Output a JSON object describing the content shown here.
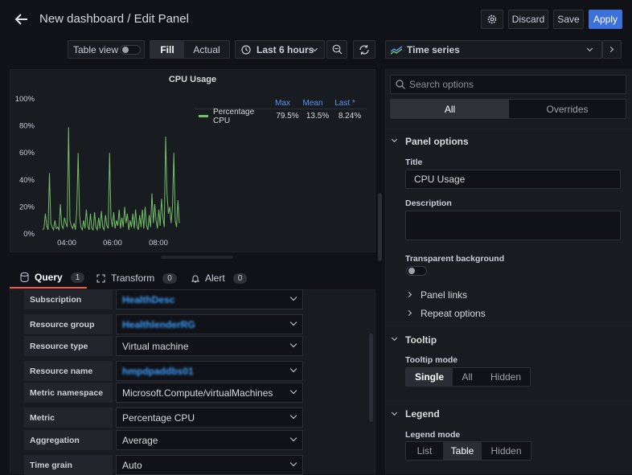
{
  "header": {
    "title": "New dashboard / Edit Panel",
    "discard_label": "Discard",
    "save_label": "Save",
    "apply_label": "Apply"
  },
  "toolbar": {
    "table_view_label": "Table view",
    "fill_label": "Fill",
    "actual_label": "Actual",
    "time_range": "Last 6 hours",
    "visualization": "Time series"
  },
  "panel": {
    "title": "CPU Usage"
  },
  "chart_data": {
    "type": "line",
    "title": "CPU Usage",
    "ylim": [
      0,
      100
    ],
    "y_ticks": [
      "100%",
      "80%",
      "60%",
      "40%",
      "20%",
      "0%"
    ],
    "x_ticks": [
      "04:00",
      "06:00",
      "08:00"
    ],
    "grid": false,
    "legend": {
      "placement": "right",
      "headers": [
        "Max",
        "Mean",
        "Last *"
      ],
      "rows": [
        {
          "name": "Percentage CPU",
          "color": "#73bf69",
          "max": "79.5%",
          "mean": "13.5%",
          "last": "8.24%"
        }
      ]
    },
    "series": [
      {
        "name": "Percentage CPU",
        "color": "#73bf69",
        "x": [
          0,
          1,
          2,
          3,
          4,
          5,
          6,
          7,
          8,
          9,
          10,
          11,
          12,
          13,
          14,
          15,
          16,
          17,
          18,
          19,
          20,
          21,
          22,
          23,
          24,
          25,
          26,
          27,
          28,
          29,
          30,
          31,
          32,
          33,
          34,
          35,
          36,
          37,
          38,
          39,
          40,
          41,
          42,
          43,
          44,
          45,
          46,
          47,
          48,
          49,
          50,
          51,
          52,
          53,
          54,
          55,
          56,
          57,
          58,
          59,
          60,
          61,
          62,
          63,
          64,
          65,
          66,
          67,
          68,
          69,
          70,
          71,
          72,
          73,
          74,
          75,
          76,
          77,
          78,
          79,
          80,
          81,
          82,
          83,
          84,
          85,
          86,
          87,
          88,
          89,
          90,
          91,
          92,
          93,
          94,
          95,
          96,
          97,
          98,
          99,
          100
        ],
        "y": [
          3,
          4,
          15,
          6,
          3,
          45,
          8,
          5,
          3,
          10,
          4,
          5,
          3,
          22,
          6,
          4,
          12,
          8,
          5,
          79,
          10,
          6,
          4,
          8,
          3,
          18,
          60,
          14,
          5,
          3,
          10,
          4,
          18,
          6,
          3,
          15,
          4,
          3,
          16,
          5,
          3,
          12,
          4,
          17,
          5,
          3,
          14,
          6,
          4,
          60,
          12,
          5,
          16,
          4,
          10,
          6,
          18,
          4,
          12,
          5,
          20,
          8,
          15,
          3,
          10,
          5,
          15,
          4,
          18,
          6,
          3,
          14,
          5,
          18,
          4,
          20,
          6,
          3,
          14,
          5,
          30,
          8,
          22,
          10,
          4,
          18,
          6,
          26,
          12,
          5,
          72,
          30,
          15,
          20,
          8,
          20,
          60,
          10,
          5,
          25,
          8
        ]
      }
    ]
  },
  "query_tabs": [
    {
      "label": "Query",
      "count": "1"
    },
    {
      "label": "Transform",
      "count": "0"
    },
    {
      "label": "Alert",
      "count": "0"
    }
  ],
  "query_rows": [
    {
      "label": "Subscription",
      "value": "HealthDesc",
      "redacted": true
    },
    {
      "label": "Resource group",
      "value": "HealthlenderRG",
      "redacted": true
    },
    {
      "label": "Resource type",
      "value": "Virtual machine",
      "redacted": false
    },
    {
      "label": "Resource name",
      "value": "hmpdpaddbs01",
      "redacted": true
    },
    {
      "label": "Metric namespace",
      "value": "Microsoft.Compute/virtualMachines",
      "redacted": false
    },
    {
      "label": "Metric",
      "value": "Percentage CPU",
      "redacted": false
    },
    {
      "label": "Aggregation",
      "value": "Average",
      "redacted": false
    },
    {
      "label": "Time grain",
      "value": "Auto",
      "redacted": false
    }
  ],
  "options": {
    "search_placeholder": "Search options",
    "tab_all": "All",
    "tab_overrides": "Overrides",
    "panel_options_title": "Panel options",
    "title_label": "Title",
    "title_value": "CPU Usage",
    "description_label": "Description",
    "transparent_label": "Transparent background",
    "panel_links": "Panel links",
    "repeat_options": "Repeat options",
    "tooltip_title": "Tooltip",
    "tooltip_mode_label": "Tooltip mode",
    "tooltip_modes": [
      "Single",
      "All",
      "Hidden"
    ],
    "legend_title": "Legend",
    "legend_mode_label": "Legend mode",
    "legend_modes": [
      "List",
      "Table",
      "Hidden"
    ]
  },
  "colors": {
    "accent": "#3d71d9",
    "series": "#73bf69",
    "tab_underline": "#f55f3e"
  }
}
